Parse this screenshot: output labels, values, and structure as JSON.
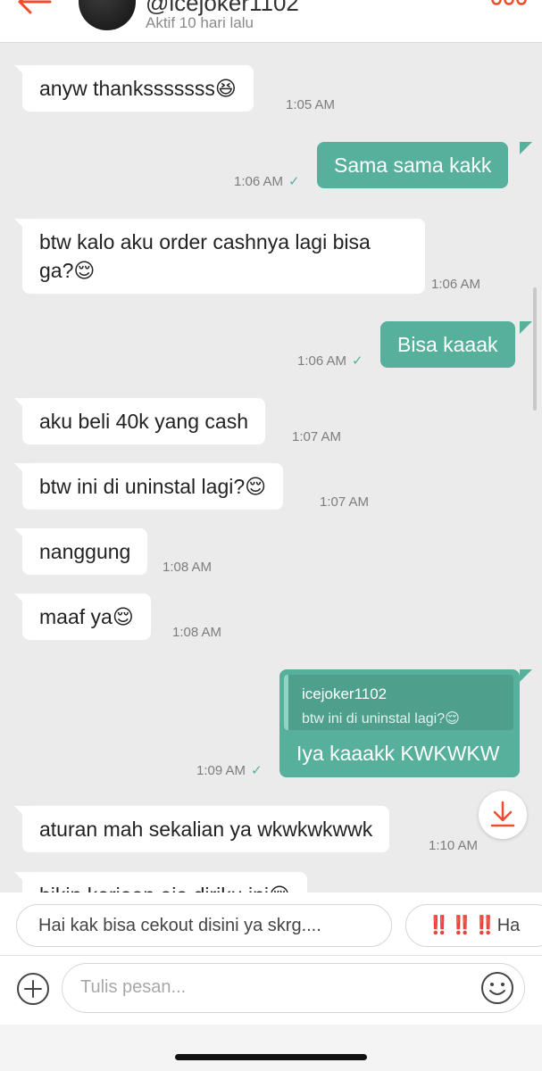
{
  "header": {
    "contact_name": "@icejoker1102",
    "status": "Aktif 10 hari lalu",
    "accent_color": "#ee4d2d",
    "back_icon": "back-arrow-icon",
    "more_icon": "more-options-icon"
  },
  "messages": [
    {
      "dir": "in",
      "text": "anyw thanksssssss😆",
      "time": "1:05 AM"
    },
    {
      "dir": "out",
      "text": "Sama sama kakk",
      "time": "1:06 AM",
      "read": true
    },
    {
      "dir": "in",
      "lines": [
        "btw kalo aku order cashnya lagi bisa",
        "ga?😌"
      ],
      "time": "1:06 AM"
    },
    {
      "dir": "out",
      "text": "Bisa kaaak",
      "time": "1:06 AM",
      "read": true
    },
    {
      "dir": "in",
      "text": "aku beli 40k yang cash",
      "time": "1:07 AM"
    },
    {
      "dir": "in",
      "text": "btw ini di uninstal lagi?😌",
      "time": "1:07 AM"
    },
    {
      "dir": "in",
      "text": "nanggung",
      "time": "1:08 AM"
    },
    {
      "dir": "in",
      "text": "maaf ya😌",
      "time": "1:08 AM"
    },
    {
      "dir": "out",
      "reply_to_user": "icejoker1102",
      "reply_to_text": "btw ini di uninstal lagi?😌",
      "text": "Iya kaaakk KWKWKW",
      "time": "1:09 AM",
      "read": true
    },
    {
      "dir": "in",
      "text": "aturan mah sekalian ya wkwkwkwwk",
      "time": "1:10 AM"
    },
    {
      "dir": "in",
      "text": "bikin kerjaan aja diriku ini😌",
      "time": ""
    }
  ],
  "quick_replies": [
    {
      "text": "Hai kak bisa cekout disini ya skrg...."
    },
    {
      "prefix": "‼️‼️‼️",
      "text": "Ha"
    }
  ],
  "composer": {
    "placeholder": "Tulis pesan...",
    "add_icon": "add-icon",
    "emoji_icon": "emoji-icon"
  },
  "colors": {
    "outgoing_bubble": "#57b09c",
    "incoming_bubble": "#ffffff",
    "chat_background": "#ebebeb",
    "read_check": "#57b09c"
  }
}
